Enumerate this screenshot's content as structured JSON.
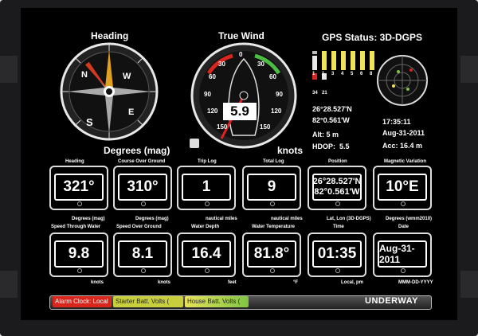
{
  "gauges": {
    "heading": {
      "title": "Heading",
      "unit": "Degrees (mag)",
      "cardinals": [
        "N",
        "E",
        "S",
        "W"
      ]
    },
    "wind": {
      "title": "True Wind",
      "unit": "knots",
      "value": "5.9",
      "scale": [
        "0",
        "30",
        "60",
        "90",
        "120",
        "150",
        "30",
        "60",
        "90",
        "120",
        "150"
      ]
    },
    "gps": {
      "title": "GPS Status: 3D-DGPS",
      "sat_ids": [
        "1",
        "1",
        "3",
        "4",
        "5",
        "6",
        "8",
        "34",
        "21"
      ],
      "lat": "26°28.527'N",
      "lon": "82°0.561'W",
      "alt": "Alt: 5 m",
      "hdop_label": "HDOP:",
      "hdop": "5.5",
      "time": "17:35:11",
      "date": "Aug-31-2011",
      "acc": "Acc: 16.4 m"
    }
  },
  "boxes_row1": [
    {
      "title": "Heading",
      "value": "321°",
      "unit": "Degrees (mag)"
    },
    {
      "title": "Course Over Ground",
      "value": "310°",
      "unit": "Degrees (mag)"
    },
    {
      "title": "Trip Log",
      "value": "1",
      "unit": "nautical miles"
    },
    {
      "title": "Total Log",
      "value": "9",
      "unit": "nautical miles"
    },
    {
      "title": "Position",
      "value_lat": "26°28.527'N",
      "value_lon": "82°0.561'W",
      "unit": "Lat, Lon (3D-DGPS)"
    },
    {
      "title": "Magnetic Variation",
      "value": "10°E",
      "unit": "Degrees (wmm2010)"
    }
  ],
  "boxes_row2": [
    {
      "title": "Speed Through Water",
      "value": "9.8",
      "unit": "knots"
    },
    {
      "title": "Speed Over Ground",
      "value": "8.1",
      "unit": "knots"
    },
    {
      "title": "Water Depth",
      "value": "16.4",
      "unit": "feet"
    },
    {
      "title": "Water Temperature",
      "value": "81.8°",
      "unit": "°F"
    },
    {
      "title": "Time",
      "value": "01:35",
      "unit": "Local, pm"
    },
    {
      "title": "Date",
      "value": "Aug-31-2011",
      "unit": "MMM-DD-YYYY"
    }
  ],
  "status": {
    "alarms": [
      "Alarm Clock: Local",
      "Starter Batt. Volts (",
      "House Batt. Volts ("
    ],
    "mode": "UNDERWAY"
  },
  "colors": {
    "alarm_red": "#d9261c",
    "alarm_yellow": "#d6d84a",
    "alarm_green": "#7fc443"
  }
}
